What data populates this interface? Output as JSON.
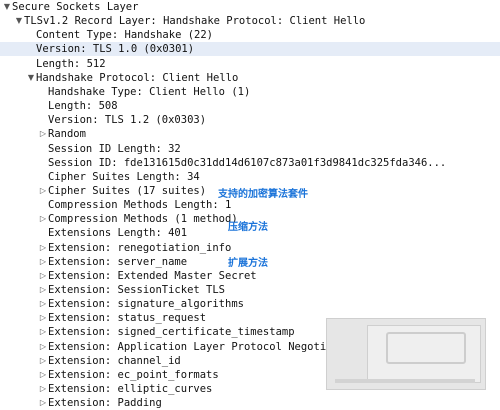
{
  "tree": [
    {
      "text": "Secure Sockets Layer",
      "twisty": "down",
      "indent": 0
    },
    {
      "text": "TLSv1.2 Record Layer: Handshake Protocol: Client Hello",
      "twisty": "down",
      "indent": 1
    },
    {
      "text": "Content Type: Handshake (22)",
      "twisty": "",
      "indent": 2
    },
    {
      "text": "Version: TLS 1.0 (0x0301)",
      "twisty": "",
      "indent": 2,
      "selected": true
    },
    {
      "text": "Length: 512",
      "twisty": "",
      "indent": 2
    },
    {
      "text": "Handshake Protocol: Client Hello",
      "twisty": "down",
      "indent": 2
    },
    {
      "text": "Handshake Type: Client Hello (1)",
      "twisty": "",
      "indent": 3
    },
    {
      "text": "Length: 508",
      "twisty": "",
      "indent": 3
    },
    {
      "text": "Version: TLS 1.2 (0x0303)",
      "twisty": "",
      "indent": 3
    },
    {
      "text": "Random",
      "twisty": "right",
      "indent": 3
    },
    {
      "text": "Session ID Length: 32",
      "twisty": "",
      "indent": 3
    },
    {
      "text": "Session ID: fde131615d0c31dd14d6107c873a01f3d9841dc325fda346...",
      "twisty": "",
      "indent": 3
    },
    {
      "text": "Cipher Suites Length: 34",
      "twisty": "",
      "indent": 3
    },
    {
      "text": "Cipher Suites (17 suites)",
      "twisty": "right",
      "indent": 3
    },
    {
      "text": "Compression Methods Length: 1",
      "twisty": "",
      "indent": 3
    },
    {
      "text": "Compression Methods (1 method)",
      "twisty": "right",
      "indent": 3
    },
    {
      "text": "Extensions Length: 401",
      "twisty": "",
      "indent": 3
    },
    {
      "text": "Extension: renegotiation_info",
      "twisty": "right",
      "indent": 3
    },
    {
      "text": "Extension: server_name",
      "twisty": "right",
      "indent": 3
    },
    {
      "text": "Extension: Extended Master Secret",
      "twisty": "right",
      "indent": 3
    },
    {
      "text": "Extension: SessionTicket TLS",
      "twisty": "right",
      "indent": 3
    },
    {
      "text": "Extension: signature_algorithms",
      "twisty": "right",
      "indent": 3
    },
    {
      "text": "Extension: status_request",
      "twisty": "right",
      "indent": 3
    },
    {
      "text": "Extension: signed_certificate_timestamp",
      "twisty": "right",
      "indent": 3
    },
    {
      "text": "Extension: Application Layer Protocol Negotiation",
      "twisty": "right",
      "indent": 3
    },
    {
      "text": "Extension: channel_id",
      "twisty": "right",
      "indent": 3
    },
    {
      "text": "Extension: ec_point_formats",
      "twisty": "right",
      "indent": 3
    },
    {
      "text": "Extension: elliptic_curves",
      "twisty": "right",
      "indent": 3
    },
    {
      "text": "Extension: Padding",
      "twisty": "right",
      "indent": 3
    }
  ],
  "annotations": {
    "cipher_suites_note": "支持的加密算法套件",
    "compression_note": "压缩方法",
    "extensions_note": "扩展方法"
  },
  "colors": {
    "selected_row": "#e5ecf7",
    "annotation": "#1a73d9"
  },
  "icons": {
    "expanded": "twisty-expanded-icon",
    "collapsed": "twisty-collapsed-icon"
  }
}
